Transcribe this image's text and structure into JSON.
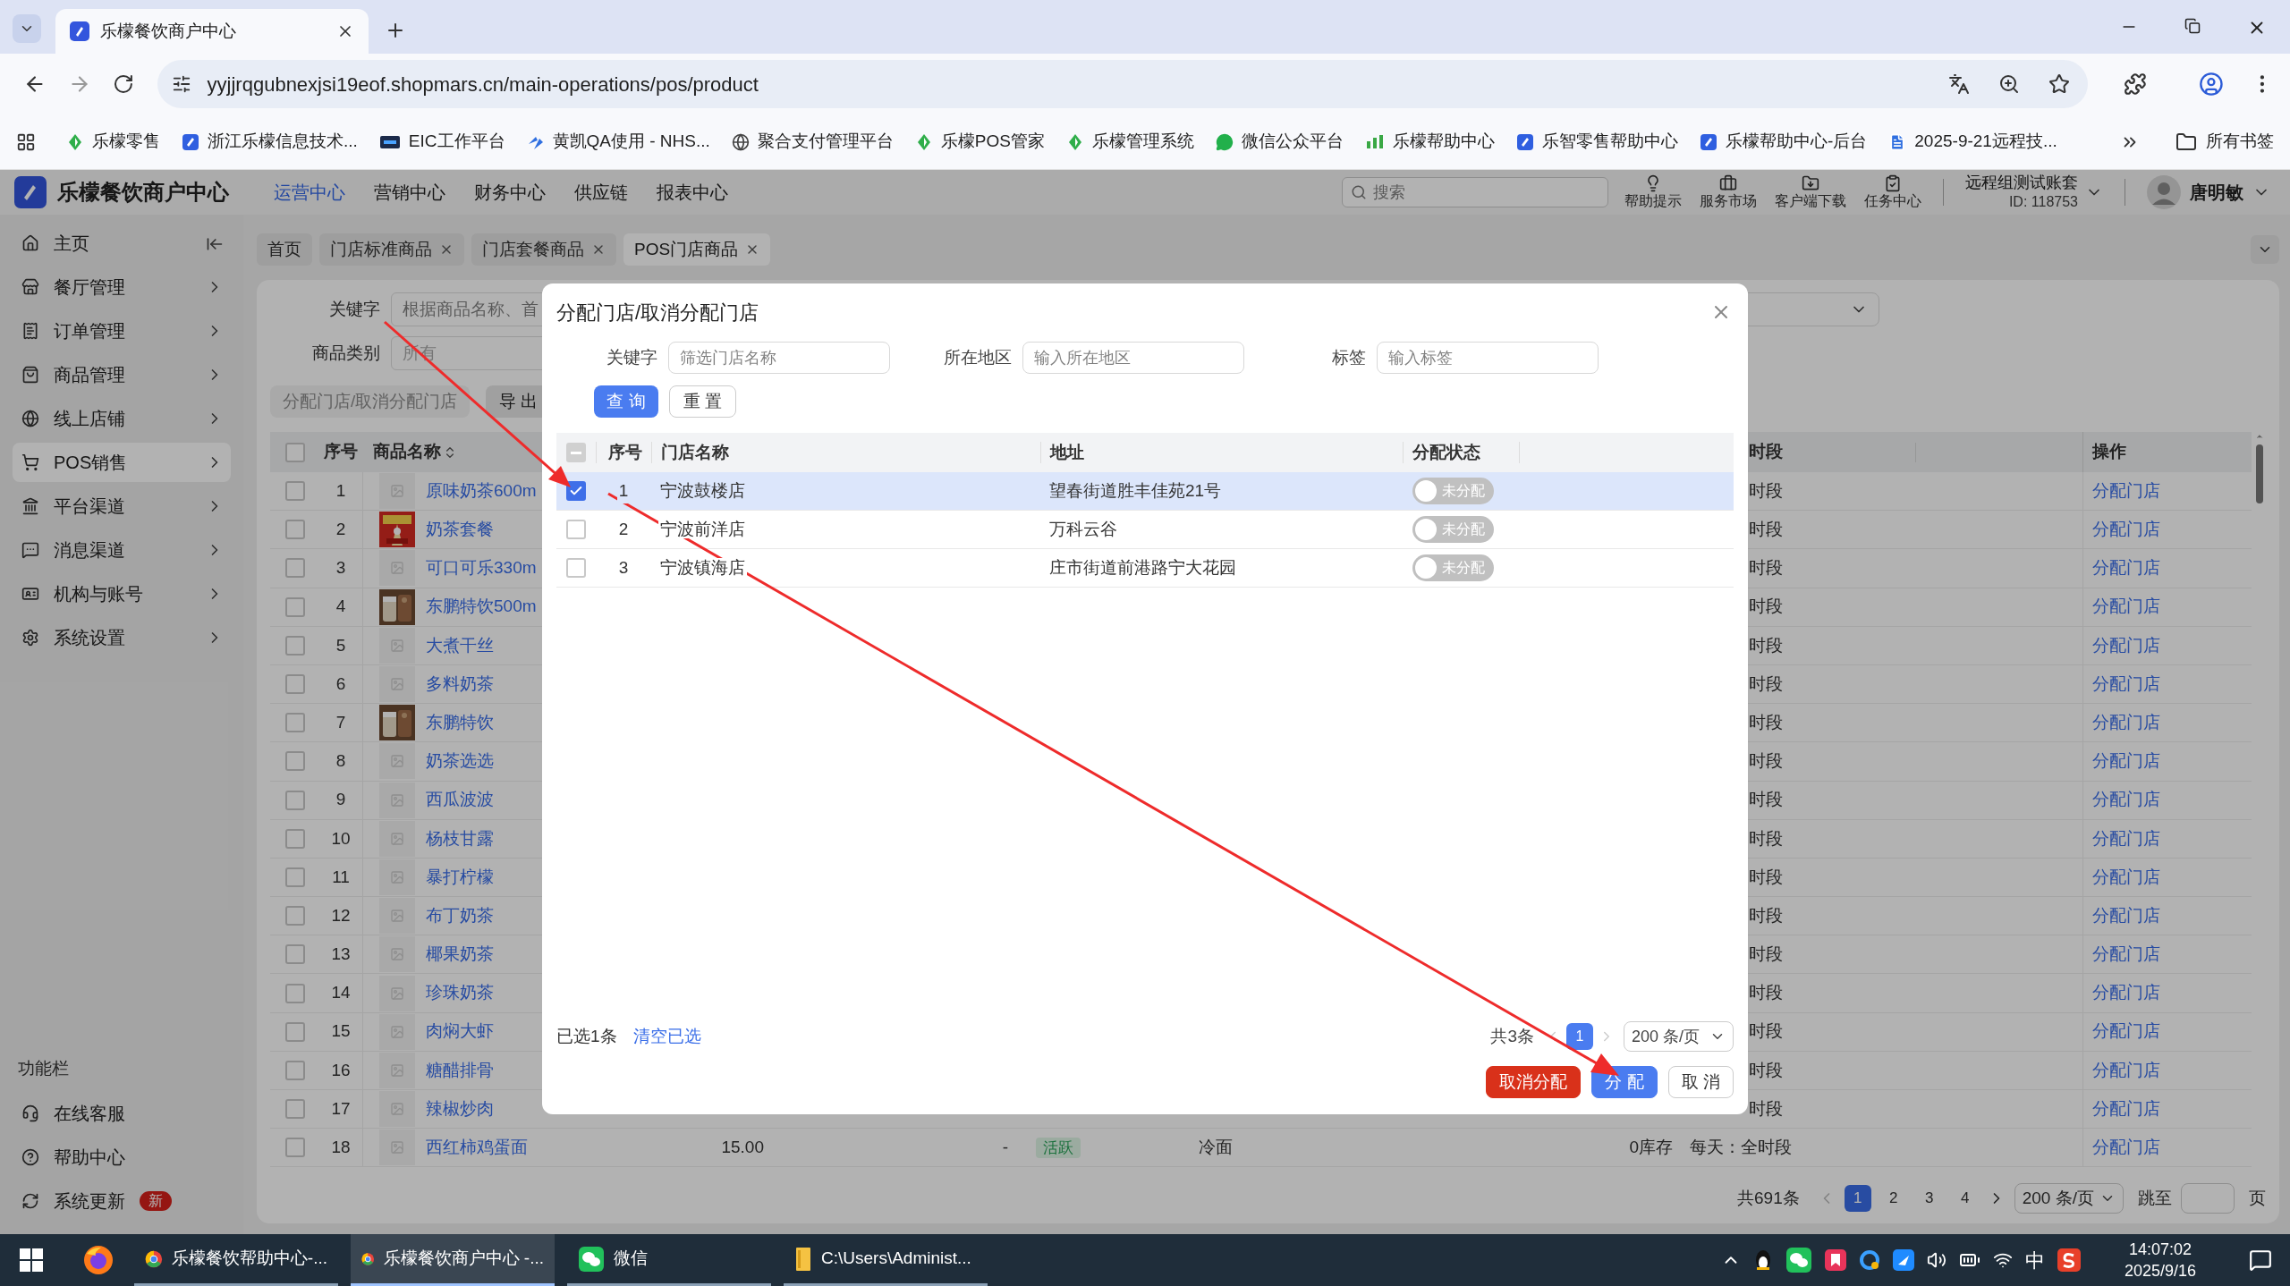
{
  "browser": {
    "tab": {
      "title": "乐檬餐饮商户中心",
      "selected": true
    },
    "url": "yyjjrqgubnexjsi19eof.shopmars.cn/main-operations/pos/product",
    "bookmarks": [
      "乐檬零售",
      "浙江乐檬信息技术...",
      "EIC工作平台",
      "黄凯QA使用 - NHS...",
      "聚合支付管理平台",
      "乐檬POS管家",
      "乐檬管理系统",
      "微信公众平台",
      "乐檬帮助中心",
      "乐智零售帮助中心",
      "乐檬帮助中心-后台",
      "2025-9-21远程技..."
    ],
    "all_bookmarks": "所有书签"
  },
  "app": {
    "brand": "乐檬餐饮商户中心",
    "nav": [
      {
        "label": "运营中心",
        "selected": true
      },
      {
        "label": "营销中心",
        "selected": false
      },
      {
        "label": "财务中心",
        "selected": false
      },
      {
        "label": "供应链",
        "selected": false
      },
      {
        "label": "报表中心",
        "selected": false
      }
    ],
    "search": {
      "placeholder": "搜索"
    },
    "tools": [
      "帮助提示",
      "服务市场",
      "客户端下载",
      "任务中心"
    ],
    "account": {
      "name": "远程组测试账套",
      "id": "ID: 118753"
    },
    "user": "唐明敏"
  },
  "sidebar": {
    "items": [
      {
        "label": "主页",
        "expandable": false,
        "selected": false
      },
      {
        "label": "餐厅管理",
        "expandable": true,
        "selected": false
      },
      {
        "label": "订单管理",
        "expandable": true,
        "selected": false
      },
      {
        "label": "商品管理",
        "expandable": true,
        "selected": false
      },
      {
        "label": "线上店铺",
        "expandable": true,
        "selected": false
      },
      {
        "label": "POS销售",
        "expandable": true,
        "selected": true
      },
      {
        "label": "平台渠道",
        "expandable": true,
        "selected": false
      },
      {
        "label": "消息渠道",
        "expandable": true,
        "selected": false
      },
      {
        "label": "机构与账号",
        "expandable": true,
        "selected": false
      },
      {
        "label": "系统设置",
        "expandable": true,
        "selected": false
      }
    ],
    "section": "功能栏",
    "utilities": [
      {
        "label": "在线客服"
      },
      {
        "label": "帮助中心"
      },
      {
        "label": "系统更新",
        "badge": "新"
      }
    ]
  },
  "tabs": [
    {
      "label": "首页",
      "closable": false,
      "selected": false
    },
    {
      "label": "门店标准商品",
      "closable": true,
      "selected": false
    },
    {
      "label": "门店套餐商品",
      "closable": true,
      "selected": false
    },
    {
      "label": "POS门店商品",
      "closable": true,
      "selected": true
    }
  ],
  "filters": {
    "keyword_label": "关键字",
    "keyword_placeholder": "根据商品名称、首",
    "category_label": "商品类别",
    "category_value": "所有"
  },
  "actions": [
    {
      "label": "分配门店/取消分配门店",
      "disabled": true
    },
    {
      "label": "导 出",
      "disabled": false
    }
  ],
  "table": {
    "select_all_checked": false,
    "columns": {
      "no": "序号",
      "name": "商品名称",
      "time": "时段",
      "action": "操作"
    },
    "rows": [
      {
        "no": "1",
        "name": "原味奶茶600m",
        "kind": "placeholder",
        "checked": false,
        "time": "时段",
        "action": "分配门店"
      },
      {
        "no": "2",
        "name": "奶茶套餐",
        "checked": false,
        "time": "时段",
        "action": "分配门店"
      },
      {
        "no": "3",
        "name": "可口可乐330m",
        "kind": "placeholder",
        "checked": false,
        "time": "时段",
        "action": "分配门店"
      },
      {
        "no": "4",
        "name": "东鹏特饮500m",
        "checked": false,
        "time": "时段",
        "action": "分配门店"
      },
      {
        "no": "5",
        "name": "大煮干丝",
        "kind": "placeholder",
        "checked": false,
        "time": "时段",
        "action": "分配门店"
      },
      {
        "no": "6",
        "name": "多料奶茶",
        "kind": "placeholder",
        "checked": false,
        "time": "时段",
        "action": "分配门店"
      },
      {
        "no": "7",
        "name": "东鹏特饮",
        "checked": false,
        "time": "时段",
        "action": "分配门店"
      },
      {
        "no": "8",
        "name": "奶茶选选",
        "kind": "placeholder",
        "checked": false,
        "time": "时段",
        "action": "分配门店"
      },
      {
        "no": "9",
        "name": "西瓜波波",
        "kind": "placeholder",
        "checked": false,
        "time": "时段",
        "action": "分配门店"
      },
      {
        "no": "10",
        "name": "杨枝甘露",
        "kind": "placeholder",
        "checked": false,
        "time": "时段",
        "action": "分配门店"
      },
      {
        "no": "11",
        "name": "暴打柠檬",
        "kind": "placeholder",
        "checked": false,
        "time": "时段",
        "action": "分配门店"
      },
      {
        "no": "12",
        "name": "布丁奶茶",
        "kind": "placeholder",
        "checked": false,
        "time": "时段",
        "action": "分配门店"
      },
      {
        "no": "13",
        "name": "椰果奶茶",
        "kind": "placeholder",
        "checked": false,
        "time": "时段",
        "action": "分配门店"
      },
      {
        "no": "14",
        "name": "珍珠奶茶",
        "kind": "placeholder",
        "checked": false,
        "time": "时段",
        "action": "分配门店"
      },
      {
        "no": "15",
        "name": "肉焖大虾",
        "kind": "placeholder",
        "checked": false,
        "time": "时段",
        "action": "分配门店"
      },
      {
        "no": "16",
        "name": "糖醋排骨",
        "kind": "placeholder",
        "checked": false,
        "time": "时段",
        "action": "分配门店"
      },
      {
        "no": "17",
        "name": "辣椒炒肉",
        "kind": "placeholder",
        "checked": false,
        "time": "时段",
        "action": "分配门店"
      },
      {
        "no": "18",
        "name": "西红柿鸡蛋面",
        "kind": "placeholder",
        "checked": false,
        "price": "15.00",
        "column_5": "-",
        "status": "活跃",
        "category": "冷面",
        "stock": "0库存",
        "time": "每天：全时段",
        "action": "分配门店"
      }
    ]
  },
  "pagination": {
    "total": "共691条",
    "pages": [
      {
        "label": "1",
        "selected": true
      },
      {
        "label": "2",
        "selected": false
      },
      {
        "label": "3",
        "selected": false
      },
      {
        "label": "4",
        "selected": false
      }
    ],
    "page_size": "200 条/页",
    "jump_label": "跳至",
    "page_unit": "页"
  },
  "dialog": {
    "title": "分配门店/取消分配门店",
    "filters": [
      {
        "label": "关键字",
        "placeholder": "筛选门店名称"
      },
      {
        "label": "所在地区",
        "placeholder": "输入所在地区"
      },
      {
        "label": "标签",
        "placeholder": "输入标签"
      }
    ],
    "search_button": "查 询",
    "reset_button": "重 置",
    "select_all": {
      "checked": false,
      "indeterminate": true
    },
    "columns": {
      "no": "序号",
      "name": "门店名称",
      "address": "地址",
      "status": "分配状态"
    },
    "rows": [
      {
        "no": "1",
        "name": "宁波鼓楼店",
        "address": "望春街道胜丰佳苑21号",
        "status": "未分配",
        "assigned": false,
        "checked": true,
        "selected": true
      },
      {
        "no": "2",
        "name": "宁波前洋店",
        "address": "万科云谷",
        "status": "未分配",
        "assigned": false,
        "checked": false,
        "selected": false
      },
      {
        "no": "3",
        "name": "宁波镇海店",
        "address": "庄市街道前港路宁大花园",
        "status": "未分配",
        "assigned": false,
        "checked": false,
        "selected": false
      }
    ],
    "selected_count": "已选1条",
    "clear_selection": "清空已选",
    "total": "共3条",
    "pages": [
      {
        "label": "1",
        "selected": true
      }
    ],
    "page_size": "200 条/页",
    "buttons": [
      {
        "label": "取消分配",
        "kind": "danger"
      },
      {
        "label": "分 配",
        "kind": "primary"
      },
      {
        "label": "取 消",
        "kind": "default"
      }
    ]
  },
  "taskbar": {
    "apps": [
      {
        "label": "乐檬餐饮帮助中心-...",
        "selected": false
      },
      {
        "label": "乐檬餐饮商户中心 -...",
        "selected": true
      },
      {
        "label": "微信",
        "selected": false
      },
      {
        "label": "C:\\Users\\Administ...",
        "selected": false
      }
    ],
    "ime": "中",
    "time": "14:07:02",
    "date": "2025/9/16"
  }
}
